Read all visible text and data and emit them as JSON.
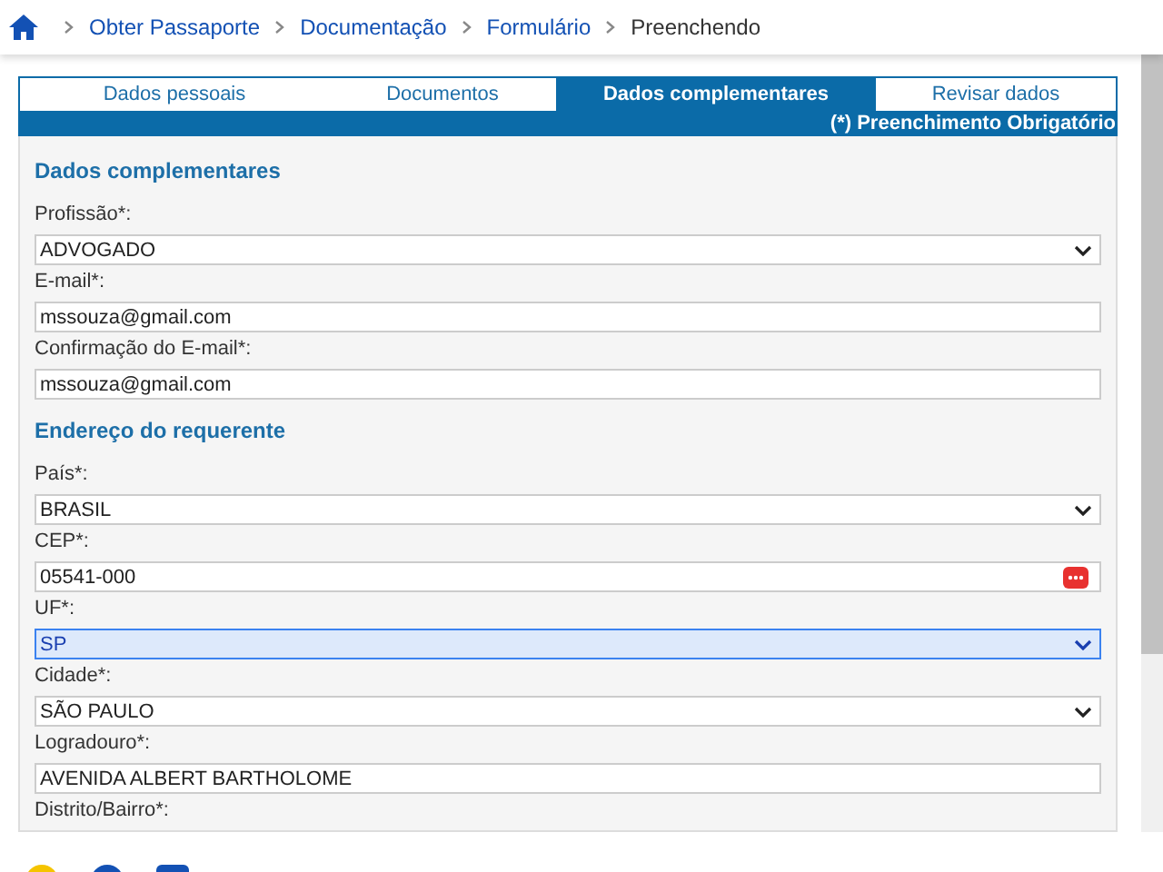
{
  "breadcrumb": [
    {
      "label": "Obter Passaporte",
      "current": false
    },
    {
      "label": "Documentação",
      "current": false
    },
    {
      "label": "Formulário",
      "current": false
    },
    {
      "label": "Preenchendo",
      "current": true
    }
  ],
  "tabs": [
    {
      "label": "Dados pessoais",
      "selected": false
    },
    {
      "label": "Documentos",
      "selected": false
    },
    {
      "label": "Dados complementares",
      "selected": true
    },
    {
      "label": "Revisar dados",
      "selected": false
    }
  ],
  "required_note": "(*) Preenchimento Obrigatório",
  "sections": [
    {
      "title": "Dados complementares",
      "fields": [
        {
          "label": "Profissão*:",
          "kind": "select",
          "value": "ADVOGADO"
        },
        {
          "label": "E-mail*:",
          "kind": "text",
          "value": "mssouza@gmail.com"
        },
        {
          "label": "Confirmação do E-mail*:",
          "kind": "text",
          "value": "mssouza@gmail.com"
        }
      ]
    },
    {
      "title": "Endereço do requerente",
      "fields": [
        {
          "label": "País*:",
          "kind": "select",
          "value": "BRASIL"
        },
        {
          "label": "CEP*:",
          "kind": "text",
          "value": "05541-000",
          "autofill_icon": true
        },
        {
          "label": "UF*:",
          "kind": "select",
          "value": "SP",
          "focused": true
        },
        {
          "label": "Cidade*:",
          "kind": "select",
          "value": "SÃO PAULO"
        },
        {
          "label": "Logradouro*:",
          "kind": "text",
          "value": "AVENIDA ALBERT BARTHOLOME"
        },
        {
          "label": "Distrito/Bairro*:",
          "kind": "label_only"
        }
      ]
    }
  ]
}
